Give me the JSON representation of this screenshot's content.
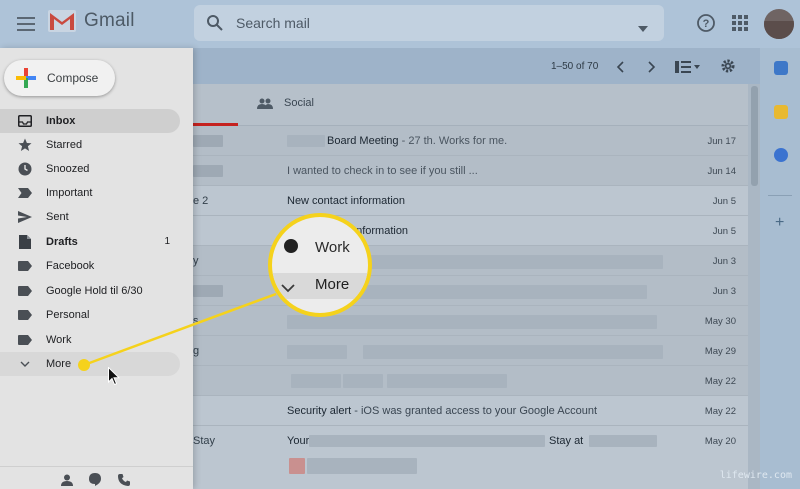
{
  "header": {
    "app_name": "Gmail",
    "search_placeholder": "Search mail"
  },
  "toolbar": {
    "pagination": "1–50 of 70"
  },
  "compose": {
    "label": "Compose"
  },
  "nav": {
    "items": [
      {
        "label": "Inbox",
        "count": "",
        "icon": "inbox-icon"
      },
      {
        "label": "Starred",
        "count": "",
        "icon": "star-icon"
      },
      {
        "label": "Snoozed",
        "count": "",
        "icon": "clock-icon"
      },
      {
        "label": "Important",
        "count": "",
        "icon": "important-icon"
      },
      {
        "label": "Sent",
        "count": "",
        "icon": "send-icon"
      },
      {
        "label": "Drafts",
        "count": "1",
        "icon": "draft-icon"
      },
      {
        "label": "Facebook",
        "count": "",
        "icon": "label-icon"
      },
      {
        "label": "Google Hold til 6/30",
        "count": "",
        "icon": "label-icon"
      },
      {
        "label": "Personal",
        "count": "",
        "icon": "label-icon"
      },
      {
        "label": "Work",
        "count": "",
        "icon": "label-icon"
      },
      {
        "label": "More",
        "count": "",
        "icon": "chevron-down-icon"
      }
    ]
  },
  "tabs": {
    "social": "Social"
  },
  "emails": [
    {
      "lead": "",
      "subject": "Board Meeting",
      "snippet": " - 27 th. Works for me.",
      "date": "Jun 17"
    },
    {
      "lead": "",
      "subject": "",
      "snippet": "I wanted to check in to see if you still ...",
      "date": "Jun 14"
    },
    {
      "lead": "e 2",
      "subject": "New contact information",
      "snippet": "",
      "date": "Jun 5"
    },
    {
      "lead": "",
      "subject": "New Contact Information",
      "snippet": "",
      "date": "Jun 5"
    },
    {
      "lead": "y",
      "subject": "",
      "snippet": "",
      "date": "Jun 3"
    },
    {
      "lead": "",
      "subject": "",
      "snippet": "",
      "date": "Jun 3"
    },
    {
      "lead": "s",
      "subject": "",
      "snippet": "",
      "date": "May 30"
    },
    {
      "lead": "g",
      "subject": "",
      "snippet": "",
      "date": "May 29"
    },
    {
      "lead": "",
      "subject": "",
      "snippet": "",
      "date": "May 22"
    },
    {
      "lead": "",
      "subject": "Security alert",
      "snippet": " - iOS was granted access to your Google Account",
      "date": "May 22"
    },
    {
      "lead": "Stay",
      "subject": "Your",
      "snippet": "Stay at",
      "date": "May 20"
    }
  ],
  "callout": {
    "upper_label": "Work",
    "lower_label": "More"
  },
  "watermark": "lifewire.com",
  "colors": {
    "highlight": "#f5d21c",
    "primary_tab": "#c5221f"
  }
}
